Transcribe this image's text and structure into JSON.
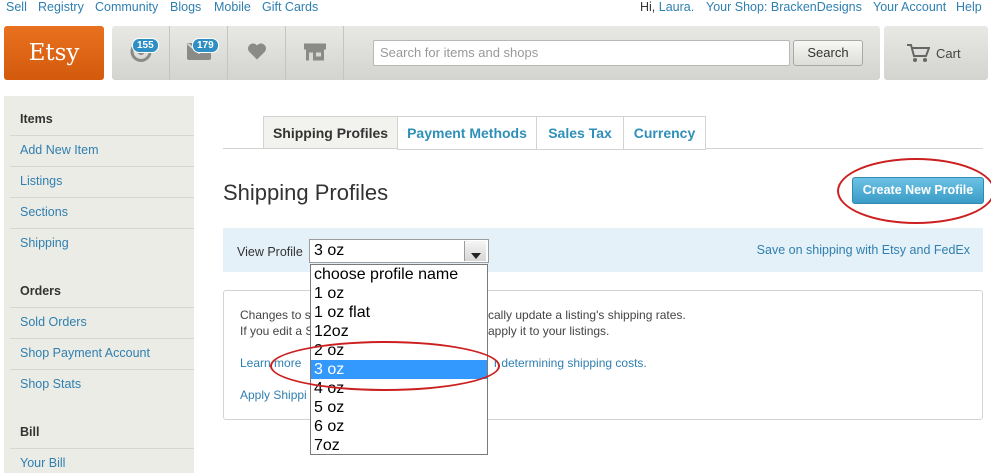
{
  "top_links": {
    "left": [
      "Sell",
      "Registry",
      "Community",
      "Blogs",
      "Mobile",
      "Gift Cards"
    ],
    "greeting": "Hi,",
    "user": "Laura.",
    "shop": "Your Shop: BrackenDesigns",
    "account": "Your Account",
    "help": "Help"
  },
  "header": {
    "logo": "Etsy",
    "activity_count": "155",
    "messages_count": "179",
    "search_placeholder": "Search for items and shops",
    "search_button": "Search",
    "cart_label": "Cart"
  },
  "sidebar": {
    "sections": [
      {
        "heading": "Items",
        "items": [
          "Add New Item",
          "Listings",
          "Sections",
          "Shipping"
        ]
      },
      {
        "heading": "Orders",
        "items": [
          "Sold Orders",
          "Shop Payment Account",
          "Shop Stats"
        ]
      },
      {
        "heading": "Bill",
        "items": [
          "Your Bill"
        ]
      }
    ]
  },
  "tabs": [
    "Shipping Profiles",
    "Payment Methods",
    "Sales Tax",
    "Currency"
  ],
  "main": {
    "title": "Shipping Profiles",
    "create_button": "Create New Profile",
    "view_profile_label": "View Profile",
    "selected_profile": "3 oz",
    "fedex_link": "Save on shipping with Etsy and FedEx",
    "info_line1_a": "Changes to s",
    "info_line1_b": "cally update a listing's shipping rates.",
    "info_line2_a": "If you edit a S",
    "info_line2_b": "apply it to your listings.",
    "learn_a": "Learn more",
    "learn_b": "r determining shipping costs.",
    "apply_link": "Apply Shippi"
  },
  "dropdown": {
    "options": [
      "choose profile name",
      "1 oz",
      "1 oz flat",
      "12oz",
      "2 oz",
      "3 oz",
      "4 oz",
      "5 oz",
      "6 oz",
      "7oz"
    ],
    "selected_index": 5
  },
  "colors": {
    "link": "#2f7fb0",
    "etsy_orange": "#e8711f",
    "accent_blue": "#3a9cc6",
    "highlight_circle": "#cc1f1f",
    "selection": "#3399ff"
  }
}
